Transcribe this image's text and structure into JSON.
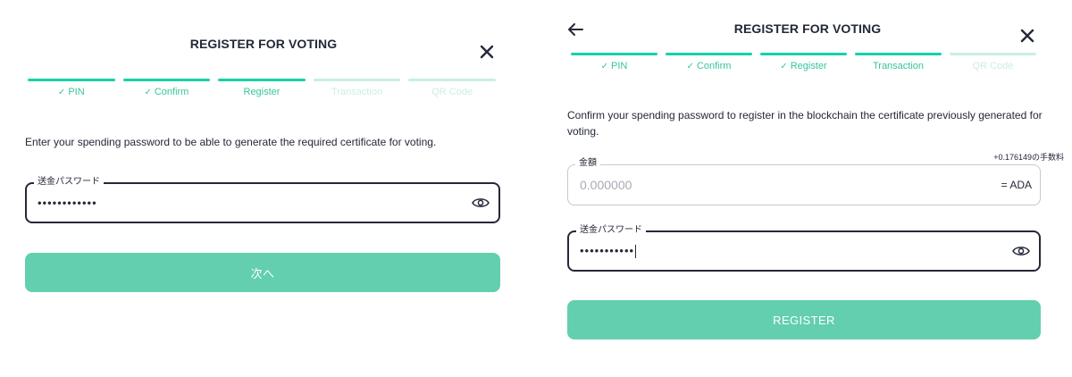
{
  "left_panel": {
    "title": "REGISTER FOR VOTING",
    "steps": [
      {
        "label": "PIN",
        "check": "✓"
      },
      {
        "label": "Confirm",
        "check": "✓"
      },
      {
        "label": "Register"
      },
      {
        "label": "Transaction"
      },
      {
        "label": "QR Code"
      }
    ],
    "description": "Enter your spending password to be able to generate the required certificate for voting.",
    "password_label": "送金パスワード",
    "password_value": "••••••••••••",
    "next_button": "次へ"
  },
  "right_panel": {
    "title": "REGISTER FOR VOTING",
    "steps": [
      {
        "label": "PIN",
        "check": "✓"
      },
      {
        "label": "Confirm",
        "check": "✓"
      },
      {
        "label": "Register",
        "check": "✓"
      },
      {
        "label": "Transaction"
      },
      {
        "label": "QR Code"
      }
    ],
    "description": "Confirm your spending password to register in the blockchain the certificate previously generated for voting.",
    "amount_label": "金額",
    "fee_text": "+0.176149の手数料",
    "amount_placeholder": "0.000000",
    "amount_suffix": "= ADA",
    "password_label": "送金パスワード",
    "password_value": "•••••••••••",
    "register_button": "REGISTER"
  },
  "colors": {
    "accent": "#17d1aa",
    "accent_light": "#c9efe4",
    "button": "#63cfae",
    "text": "#242838"
  },
  "icons": [
    "close-icon",
    "back-arrow-icon",
    "eye-icon",
    "check-icon"
  ]
}
